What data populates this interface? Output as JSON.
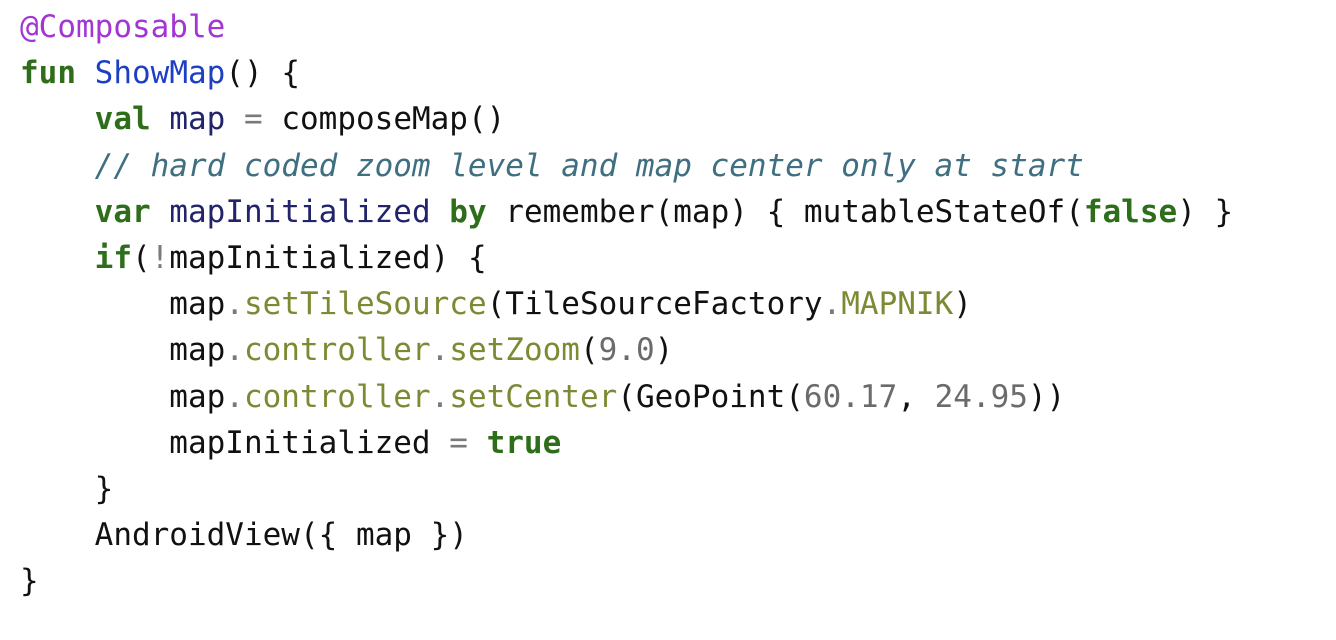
{
  "code": {
    "colors": {
      "annotation": "#a335d4",
      "keyword": "#2e6e1b",
      "function": "#1d3fc4",
      "variable": "#22246b",
      "operator": "#7a7a7a",
      "comment": "#3f6f80",
      "member": "#7d8a34",
      "number": "#6b6b6b",
      "plain": "#111111"
    },
    "lines": [
      [
        [
          "annotation",
          "@Composable"
        ]
      ],
      [
        [
          "keyword",
          "fun"
        ],
        [
          "plain",
          " "
        ],
        [
          "function",
          "ShowMap"
        ],
        [
          "plain",
          "() {"
        ]
      ],
      [
        [
          "plain",
          "    "
        ],
        [
          "keyword",
          "val"
        ],
        [
          "plain",
          " "
        ],
        [
          "variable",
          "map"
        ],
        [
          "plain",
          " "
        ],
        [
          "operator",
          "="
        ],
        [
          "plain",
          " composeMap()"
        ]
      ],
      [
        [
          "plain",
          "    "
        ],
        [
          "comment",
          "// hard coded zoom level and map center only at start"
        ]
      ],
      [
        [
          "plain",
          "    "
        ],
        [
          "keyword",
          "var"
        ],
        [
          "plain",
          " "
        ],
        [
          "variable",
          "mapInitialized"
        ],
        [
          "plain",
          " "
        ],
        [
          "keyword",
          "by"
        ],
        [
          "plain",
          " remember(map) { mutableStateOf("
        ],
        [
          "keyword",
          "false"
        ],
        [
          "plain",
          ") }"
        ]
      ],
      [
        [
          "plain",
          "    "
        ],
        [
          "keyword",
          "if"
        ],
        [
          "plain",
          "("
        ],
        [
          "operator",
          "!"
        ],
        [
          "plain",
          "mapInitialized) {"
        ]
      ],
      [
        [
          "plain",
          "        map"
        ],
        [
          "operator",
          "."
        ],
        [
          "member",
          "setTileSource"
        ],
        [
          "plain",
          "(TileSourceFactory"
        ],
        [
          "operator",
          "."
        ],
        [
          "member",
          "MAPNIK"
        ],
        [
          "plain",
          ")"
        ]
      ],
      [
        [
          "plain",
          "        map"
        ],
        [
          "operator",
          "."
        ],
        [
          "member",
          "controller"
        ],
        [
          "operator",
          "."
        ],
        [
          "member",
          "setZoom"
        ],
        [
          "plain",
          "("
        ],
        [
          "number",
          "9.0"
        ],
        [
          "plain",
          ")"
        ]
      ],
      [
        [
          "plain",
          "        map"
        ],
        [
          "operator",
          "."
        ],
        [
          "member",
          "controller"
        ],
        [
          "operator",
          "."
        ],
        [
          "member",
          "setCenter"
        ],
        [
          "plain",
          "(GeoPoint("
        ],
        [
          "number",
          "60.17"
        ],
        [
          "plain",
          ", "
        ],
        [
          "number",
          "24.95"
        ],
        [
          "plain",
          "))"
        ]
      ],
      [
        [
          "plain",
          "        mapInitialized "
        ],
        [
          "operator",
          "="
        ],
        [
          "plain",
          " "
        ],
        [
          "keyword",
          "true"
        ]
      ],
      [
        [
          "plain",
          "    }"
        ]
      ],
      [
        [
          "plain",
          "    AndroidView({ map })"
        ]
      ],
      [
        [
          "plain",
          "}"
        ]
      ]
    ]
  }
}
